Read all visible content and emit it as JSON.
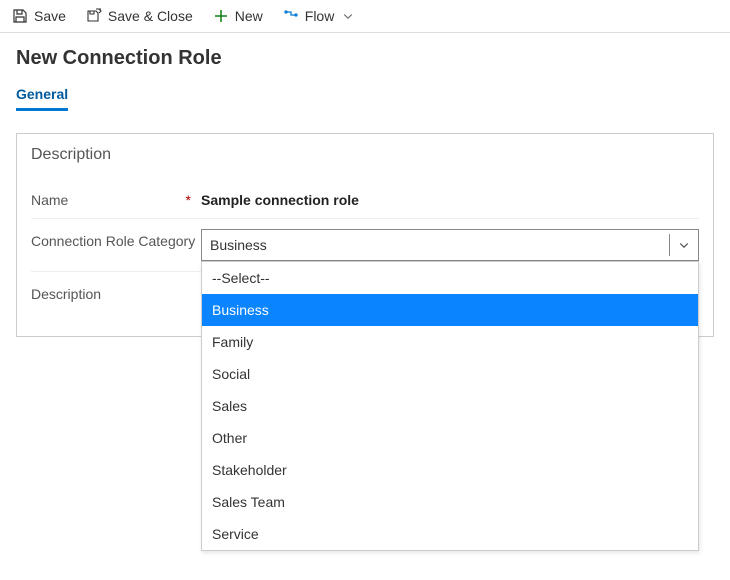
{
  "toolbar": {
    "save": "Save",
    "save_close": "Save & Close",
    "new": "New",
    "flow": "Flow"
  },
  "page": {
    "title": "New Connection Role"
  },
  "tabs": {
    "general": "General"
  },
  "section": {
    "title": "Description",
    "labels": {
      "name": "Name",
      "category": "Connection Role Category",
      "description": "Description"
    },
    "required_marker": "*"
  },
  "fields": {
    "name_value": "Sample connection role",
    "category_selected": "Business",
    "description_value": ""
  },
  "category_options": {
    "placeholder": "--Select--",
    "items": [
      "Business",
      "Family",
      "Social",
      "Sales",
      "Other",
      "Stakeholder",
      "Sales Team",
      "Service"
    ],
    "highlighted_index": 0
  }
}
